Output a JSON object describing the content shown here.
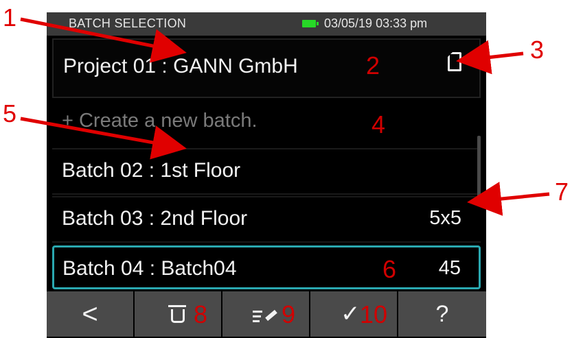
{
  "status": {
    "title": "BATCH SELECTION",
    "datetime": "03/05/19 03:33 pm",
    "battery_color": "#27d827"
  },
  "project": {
    "label": "Project 01 : GANN GmbH",
    "storage_icon": "sd-card-icon"
  },
  "new_batch": {
    "label": "+ Create a new batch."
  },
  "batches": [
    {
      "label": "Batch 02 : 1st Floor",
      "value": ""
    },
    {
      "label": "Batch 03 : 2nd Floor",
      "value": "5x5"
    },
    {
      "label": "Batch 04 : Batch04",
      "value": "45",
      "selected": true
    }
  ],
  "toolbar": {
    "back": "<",
    "delete_icon": "trash-icon",
    "edit_icon": "edit-icon",
    "confirm": "✓",
    "help": "?"
  },
  "annotations": [
    "1",
    "2",
    "3",
    "4",
    "5",
    "6",
    "7",
    "8",
    "9",
    "10"
  ],
  "colors": {
    "accent_selected": "#2aa8b0",
    "annotation": "#e00000"
  }
}
